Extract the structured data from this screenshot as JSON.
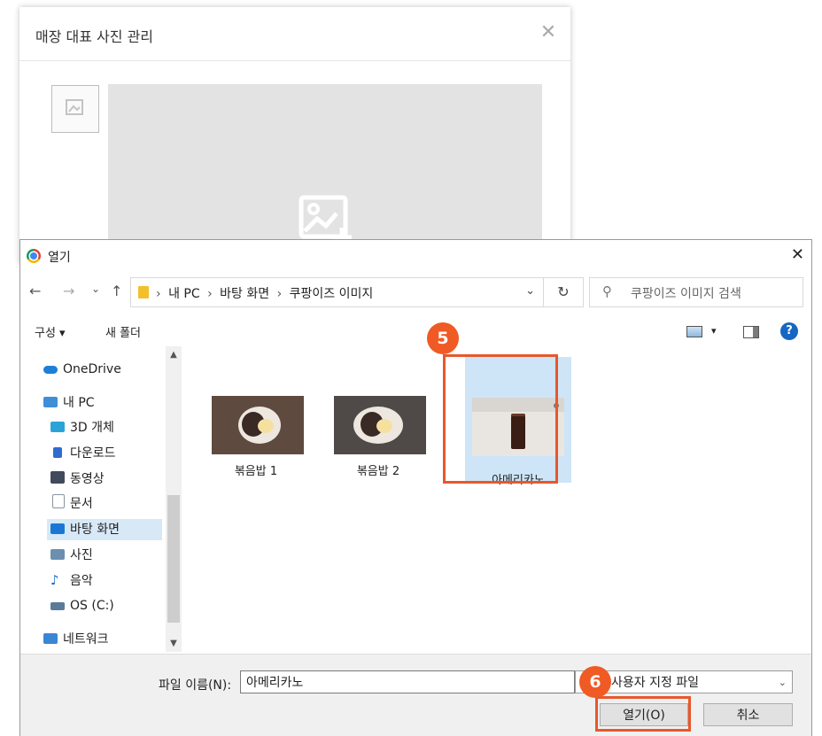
{
  "background_modal": {
    "title": "매장 대표 사진 관리",
    "close_glyph": "✕"
  },
  "dialog": {
    "title": "열기",
    "close_glyph": "✕",
    "nav": {
      "back": "←",
      "forward": "→",
      "recent": "⌄",
      "up": "↑"
    },
    "breadcrumbs": [
      "내 PC",
      "바탕 화면",
      "쿠팡이즈 이미지"
    ],
    "breadcrumb_sep": "›",
    "refresh_glyph": "↻",
    "search_placeholder": "쿠팡이즈 이미지 검색",
    "toolbar": {
      "organize": "구성 ▾",
      "new_folder": "새 폴더",
      "view_dropdown": "▾",
      "help": "?"
    },
    "sidebar": [
      {
        "label": "OneDrive",
        "icon": "cloud-icon",
        "color": "#1e7fd6"
      },
      {
        "label": "내 PC",
        "icon": "computer-icon",
        "color": "#3f8fd8"
      },
      {
        "label": "3D 개체",
        "icon": "cube-icon",
        "color": "#2aa4d8"
      },
      {
        "label": "다운로드",
        "icon": "download-arrow-icon",
        "color": "#2f6bd0"
      },
      {
        "label": "동영상",
        "icon": "film-icon",
        "color": "#404a5c"
      },
      {
        "label": "문서",
        "icon": "document-icon",
        "color": "#8a94a3"
      },
      {
        "label": "바탕 화면",
        "icon": "desktop-icon",
        "color": "#1a78d4",
        "selected": true
      },
      {
        "label": "사진",
        "icon": "picture-icon",
        "color": "#6c8fb0"
      },
      {
        "label": "음악",
        "icon": "music-note-icon",
        "color": "#1a6ed0"
      },
      {
        "label": "OS (C:)",
        "icon": "drive-icon",
        "color": "#5a7a9a"
      },
      {
        "label": "네트워크",
        "icon": "network-icon",
        "color": "#3a86d4"
      }
    ],
    "files": [
      {
        "name": "볶음밥 1"
      },
      {
        "name": "볶음밥 2"
      },
      {
        "name": "아메리카노",
        "selected": true
      }
    ],
    "filename_label": "파일 이름(N):",
    "filename_value": "아메리카노",
    "filetype_value": "사용자 지정 파일",
    "open_button": "열기(O)",
    "cancel_button": "취소"
  },
  "annotations": {
    "step5": "5",
    "step6": "6",
    "accent": "#e8572c"
  }
}
